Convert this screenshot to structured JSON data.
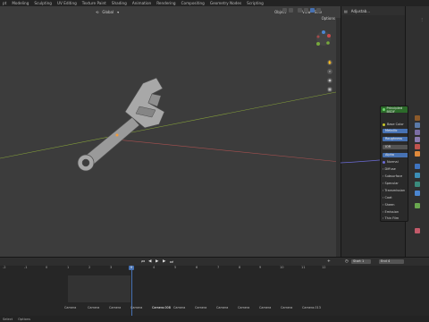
{
  "topbar": {
    "tabs": [
      "pt",
      "Modeling",
      "Sculpting",
      "UV Editing",
      "Texture Paint",
      "Shading",
      "Animation",
      "Rendering",
      "Compositing",
      "Geometry Nodes",
      "Scripting"
    ]
  },
  "viewport": {
    "header": {
      "transform_orientation": "Global",
      "mode": "Object",
      "view_menu": "View",
      "select_menu": "Sele",
      "options_label": "Options"
    },
    "object_name": "Adjustable Wrench"
  },
  "outliner": {
    "header_label": "Adjustab...",
    "rows": []
  },
  "properties_tabs": [
    "render",
    "output",
    "view-layer",
    "scene",
    "world",
    "object",
    "modifier",
    "particles",
    "physics",
    "constraints",
    "data",
    "material"
  ],
  "material_panel": {
    "header": "Principled BSDF",
    "rows": [
      {
        "label": "Base Color",
        "kind": "text"
      },
      {
        "label": "Metallic",
        "kind": "field"
      },
      {
        "label": "Roughness",
        "kind": "field"
      },
      {
        "label": "IOR",
        "kind": "grey"
      },
      {
        "label": "Alpha",
        "kind": "field"
      },
      {
        "label": "Normal",
        "kind": "text"
      },
      {
        "label": "Diffuse",
        "kind": "sub"
      },
      {
        "label": "Subsurface",
        "kind": "sub"
      },
      {
        "label": "Specular",
        "kind": "sub"
      },
      {
        "label": "Transmission",
        "kind": "sub"
      },
      {
        "label": "Coat",
        "kind": "sub"
      },
      {
        "label": "Sheen",
        "kind": "sub"
      },
      {
        "label": "Emission",
        "kind": "sub"
      },
      {
        "label": "Thin Film",
        "kind": "sub"
      }
    ]
  },
  "timeline": {
    "start_label": "Start",
    "start_value": "1",
    "end_label": "End",
    "end_value": "4",
    "current_frame": "0",
    "ruler": [
      "-2",
      "-1",
      "0",
      "1",
      "2",
      "3",
      "4",
      "5",
      "6",
      "7",
      "8",
      "9",
      "10",
      "11",
      "12",
      "13"
    ],
    "markers": [
      "Camera",
      "Camera",
      "Camera",
      "Camera",
      "Camera.008",
      "Camera",
      "Camera",
      "Camera",
      "Camera",
      "Camera",
      "Camera",
      "Camera.013"
    ]
  },
  "statusbar": {
    "items": [
      "Select",
      "Options"
    ]
  },
  "colors": {
    "accent": "#4772b3",
    "node_header": "#2c6b2a",
    "viewport_bg": "#3c3c3c",
    "x_axis": "#a7504f",
    "y_axis": "#86a23a"
  }
}
